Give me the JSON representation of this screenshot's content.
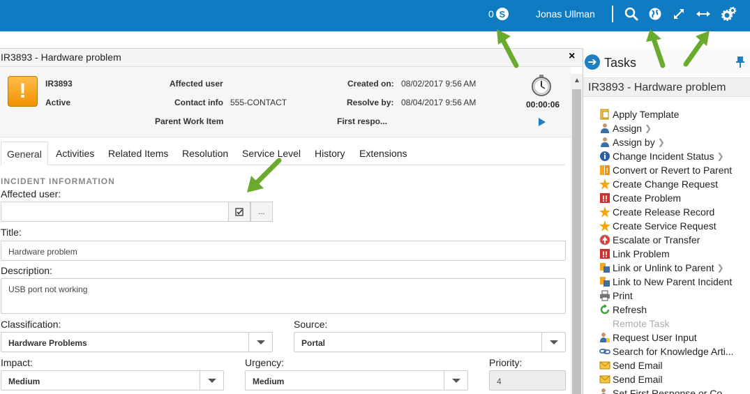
{
  "topbar": {
    "count": "0",
    "skype_icon": "skype-icon",
    "user_name": "Jonas Ullman",
    "icons": [
      "search-icon",
      "globe-icon",
      "expand-icon",
      "horizontal-resize-icon",
      "gears-icon"
    ]
  },
  "form": {
    "title": "IR3893 - Hardware problem",
    "close_label": "×",
    "summary": {
      "id": "IR3893",
      "status": "Active",
      "affected_user_label": "Affected user",
      "contact_info_label": "Contact info",
      "contact_info_value": "555-CONTACT",
      "parent_work_item_label": "Parent Work Item",
      "created_on_label": "Created on:",
      "created_on_value": "08/02/2017 9:56 AM",
      "resolve_by_label": "Resolve by:",
      "resolve_by_value": "08/04/2017 9:56 AM",
      "first_response_label": "First respo...",
      "timer": "00:00:06"
    },
    "tabs": [
      "General",
      "Activities",
      "Related Items",
      "Resolution",
      "Service Level",
      "History",
      "Extensions"
    ],
    "section_title": "INCIDENT INFORMATION",
    "affected_user_field_label": "Affected user:",
    "affected_user_value": "",
    "title_label": "Title:",
    "title_value": "Hardware problem",
    "description_label": "Description:",
    "description_value": "USB port not working",
    "classification_label": "Classification:",
    "classification_value": "Hardware Problems",
    "source_label": "Source:",
    "source_value": "Portal",
    "impact_label": "Impact:",
    "impact_value": "Medium",
    "urgency_label": "Urgency:",
    "urgency_value": "Medium",
    "priority_label": "Priority:",
    "priority_value": "4",
    "ellipsis_button": "..."
  },
  "tasks": {
    "title": "Tasks",
    "subtitle": "IR3893 - Hardware problem",
    "items": [
      {
        "label": "Apply Template",
        "icon": "template-icon",
        "submenu": false,
        "enabled": true
      },
      {
        "label": "Assign",
        "icon": "user-icon",
        "submenu": true,
        "enabled": true
      },
      {
        "label": "Assign by",
        "icon": "user-icon",
        "submenu": true,
        "enabled": true
      },
      {
        "label": "Change Incident Status",
        "icon": "info-icon",
        "submenu": true,
        "enabled": true
      },
      {
        "label": "Convert or Revert to Parent",
        "icon": "convert-icon",
        "submenu": false,
        "enabled": true
      },
      {
        "label": "Create Change Request",
        "icon": "star-icon",
        "submenu": false,
        "enabled": true
      },
      {
        "label": "Create Problem",
        "icon": "problem-icon",
        "submenu": false,
        "enabled": true
      },
      {
        "label": "Create Release Record",
        "icon": "star-icon",
        "submenu": false,
        "enabled": true
      },
      {
        "label": "Create Service Request",
        "icon": "star-icon",
        "submenu": false,
        "enabled": true
      },
      {
        "label": "Escalate or Transfer",
        "icon": "escalate-icon",
        "submenu": false,
        "enabled": true
      },
      {
        "label": "Link Problem",
        "icon": "problem-icon",
        "submenu": false,
        "enabled": true
      },
      {
        "label": "Link or Unlink to Parent",
        "icon": "link-parent-icon",
        "submenu": true,
        "enabled": true
      },
      {
        "label": "Link to New Parent Incident",
        "icon": "link-parent-icon",
        "submenu": false,
        "enabled": true
      },
      {
        "label": "Print",
        "icon": "printer-icon",
        "submenu": false,
        "enabled": true
      },
      {
        "label": "Refresh",
        "icon": "refresh-icon",
        "submenu": false,
        "enabled": true
      },
      {
        "label": "Remote Task",
        "icon": "",
        "submenu": false,
        "enabled": false
      },
      {
        "label": "Request User Input",
        "icon": "user-input-icon",
        "submenu": false,
        "enabled": true
      },
      {
        "label": "Search for Knowledge Arti...",
        "icon": "link-icon",
        "submenu": false,
        "enabled": true
      },
      {
        "label": "Send Email",
        "icon": "email-icon",
        "submenu": false,
        "enabled": true
      },
      {
        "label": "Send Email",
        "icon": "email-icon",
        "submenu": false,
        "enabled": true
      },
      {
        "label": "Set First Response or Co...",
        "icon": "user-input-icon",
        "submenu": false,
        "enabled": true
      }
    ]
  },
  "colors": {
    "topbar": "#0f7bc3",
    "annotation_arrow": "#6aab2e",
    "warning": "#f29200"
  }
}
